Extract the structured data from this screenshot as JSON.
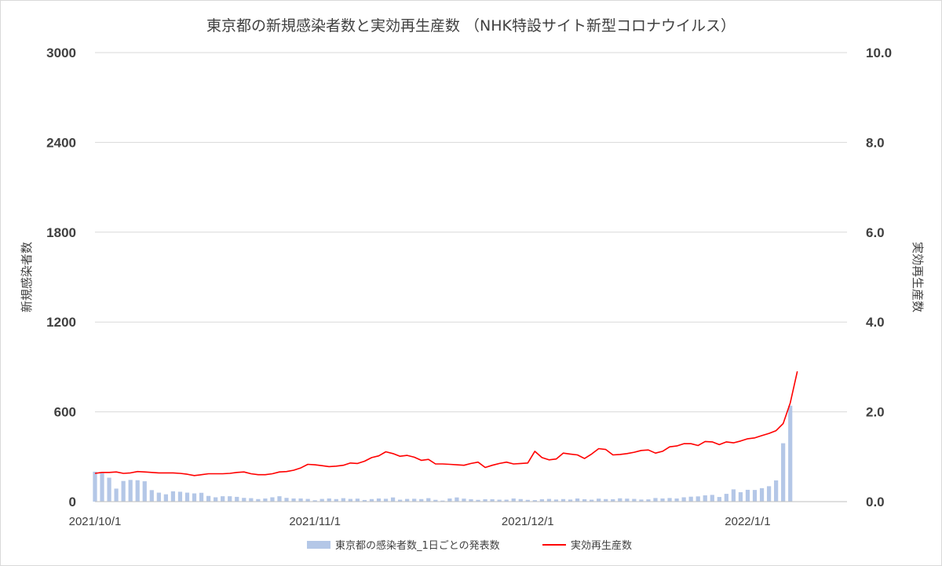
{
  "chart_data": {
    "type": "bar+line",
    "title": "東京都の新規感染者数と実効再生産数 （NHK特設サイト新型コロナウイルス）",
    "y_left": {
      "label": "新規感染者数",
      "lim": [
        0,
        3000
      ],
      "ticks": [
        "0",
        "600",
        "1200",
        "1800",
        "2400",
        "3000"
      ],
      "tick_values": [
        0,
        600,
        1200,
        1800,
        2400,
        3000
      ]
    },
    "y_right": {
      "label": "実効再生産数",
      "lim": [
        0,
        10
      ],
      "ticks": [
        "0.0",
        "2.0",
        "4.0",
        "6.0",
        "8.0",
        "10.0"
      ],
      "tick_values": [
        0,
        2,
        4,
        6,
        8,
        10
      ]
    },
    "x_ticks": [
      "2021/10/1",
      "2021/11/1",
      "2021/12/1",
      "2022/1/1"
    ],
    "x_tick_dates": [
      "2021-10-01",
      "2021-11-01",
      "2021-12-01",
      "2022-01-01"
    ],
    "x_range": [
      "2021-10-01",
      "2022-01-15"
    ],
    "grid": true,
    "legend_position": "bottom",
    "colors": {
      "bars": "#b4c7e7",
      "line": "#ff0000",
      "grid": "#d9d9d9",
      "text": "#404040"
    },
    "series": [
      {
        "name": "東京都の感染者数_1日ごとの発表数",
        "kind": "bar",
        "axis": "left",
        "dates": [
          "2021-10-01",
          "2021-10-02",
          "2021-10-03",
          "2021-10-04",
          "2021-10-05",
          "2021-10-06",
          "2021-10-07",
          "2021-10-08",
          "2021-10-09",
          "2021-10-10",
          "2021-10-11",
          "2021-10-12",
          "2021-10-13",
          "2021-10-14",
          "2021-10-15",
          "2021-10-16",
          "2021-10-17",
          "2021-10-18",
          "2021-10-19",
          "2021-10-20",
          "2021-10-21",
          "2021-10-22",
          "2021-10-23",
          "2021-10-24",
          "2021-10-25",
          "2021-10-26",
          "2021-10-27",
          "2021-10-28",
          "2021-10-29",
          "2021-10-30",
          "2021-10-31",
          "2021-11-01",
          "2021-11-02",
          "2021-11-03",
          "2021-11-04",
          "2021-11-05",
          "2021-11-06",
          "2021-11-07",
          "2021-11-08",
          "2021-11-09",
          "2021-11-10",
          "2021-11-11",
          "2021-11-12",
          "2021-11-13",
          "2021-11-14",
          "2021-11-15",
          "2021-11-16",
          "2021-11-17",
          "2021-11-18",
          "2021-11-19",
          "2021-11-20",
          "2021-11-21",
          "2021-11-22",
          "2021-11-23",
          "2021-11-24",
          "2021-11-25",
          "2021-11-26",
          "2021-11-27",
          "2021-11-28",
          "2021-11-29",
          "2021-11-30",
          "2021-12-01",
          "2021-12-02",
          "2021-12-03",
          "2021-12-04",
          "2021-12-05",
          "2021-12-06",
          "2021-12-07",
          "2021-12-08",
          "2021-12-09",
          "2021-12-10",
          "2021-12-11",
          "2021-12-12",
          "2021-12-13",
          "2021-12-14",
          "2021-12-15",
          "2021-12-16",
          "2021-12-17",
          "2021-12-18",
          "2021-12-19",
          "2021-12-20",
          "2021-12-21",
          "2021-12-22",
          "2021-12-23",
          "2021-12-24",
          "2021-12-25",
          "2021-12-26",
          "2021-12-27",
          "2021-12-28",
          "2021-12-29",
          "2021-12-30",
          "2021-12-31",
          "2022-01-01",
          "2022-01-02",
          "2022-01-03",
          "2022-01-04",
          "2022-01-05",
          "2022-01-06",
          "2022-01-07"
        ],
        "values": [
          200,
          190,
          160,
          87,
          138,
          145,
          143,
          136,
          77,
          60,
          49,
          69,
          66,
          60,
          55,
          59,
          38,
          29,
          36,
          36,
          32,
          25,
          23,
          17,
          21,
          29,
          36,
          25,
          21,
          21,
          18,
          9,
          18,
          21,
          17,
          23,
          18,
          20,
          11,
          17,
          21,
          19,
          28,
          13,
          18,
          19,
          17,
          23,
          12,
          7,
          21,
          28,
          20,
          16,
          12,
          16,
          16,
          13,
          13,
          21,
          17,
          12,
          10,
          16,
          18,
          14,
          17,
          14,
          21,
          16,
          13,
          20,
          17,
          16,
          22,
          20,
          18,
          14,
          15,
          24,
          21,
          24,
          21,
          29,
          33,
          35,
          42,
          45,
          31,
          52,
          82,
          63,
          79,
          78,
          90,
          103,
          142,
          390,
          641
        ]
      },
      {
        "name": "実効再生産数",
        "kind": "line",
        "axis": "right",
        "dates": [
          "2021-10-01",
          "2021-10-02",
          "2021-10-03",
          "2021-10-04",
          "2021-10-05",
          "2021-10-06",
          "2021-10-07",
          "2021-10-08",
          "2021-10-09",
          "2021-10-10",
          "2021-10-11",
          "2021-10-12",
          "2021-10-13",
          "2021-10-14",
          "2021-10-15",
          "2021-10-16",
          "2021-10-17",
          "2021-10-18",
          "2021-10-19",
          "2021-10-20",
          "2021-10-21",
          "2021-10-22",
          "2021-10-23",
          "2021-10-24",
          "2021-10-25",
          "2021-10-26",
          "2021-10-27",
          "2021-10-28",
          "2021-10-29",
          "2021-10-30",
          "2021-10-31",
          "2021-11-01",
          "2021-11-02",
          "2021-11-03",
          "2021-11-04",
          "2021-11-05",
          "2021-11-06",
          "2021-11-07",
          "2021-11-08",
          "2021-11-09",
          "2021-11-10",
          "2021-11-11",
          "2021-11-12",
          "2021-11-13",
          "2021-11-14",
          "2021-11-15",
          "2021-11-16",
          "2021-11-17",
          "2021-11-18",
          "2021-11-19",
          "2021-11-20",
          "2021-11-21",
          "2021-11-22",
          "2021-11-23",
          "2021-11-24",
          "2021-11-25",
          "2021-11-26",
          "2021-11-27",
          "2021-11-28",
          "2021-11-29",
          "2021-11-30",
          "2021-12-01",
          "2021-12-02",
          "2021-12-03",
          "2021-12-04",
          "2021-12-05",
          "2021-12-06",
          "2021-12-07",
          "2021-12-08",
          "2021-12-09",
          "2021-12-10",
          "2021-12-11",
          "2021-12-12",
          "2021-12-13",
          "2021-12-14",
          "2021-12-15",
          "2021-12-16",
          "2021-12-17",
          "2021-12-18",
          "2021-12-19",
          "2021-12-20",
          "2021-12-21",
          "2021-12-22",
          "2021-12-23",
          "2021-12-24",
          "2021-12-25",
          "2021-12-26",
          "2021-12-27",
          "2021-12-28",
          "2021-12-29",
          "2021-12-30",
          "2021-12-31",
          "2022-01-01",
          "2022-01-02",
          "2022-01-03",
          "2022-01-04",
          "2022-01-05",
          "2022-01-06",
          "2022-01-07",
          "2022-01-08"
        ],
        "values": [
          0.63,
          0.65,
          0.65,
          0.66,
          0.63,
          0.64,
          0.67,
          0.66,
          0.65,
          0.64,
          0.64,
          0.64,
          0.63,
          0.61,
          0.58,
          0.6,
          0.62,
          0.62,
          0.62,
          0.63,
          0.65,
          0.66,
          0.62,
          0.6,
          0.6,
          0.62,
          0.66,
          0.67,
          0.7,
          0.75,
          0.83,
          0.82,
          0.8,
          0.78,
          0.79,
          0.81,
          0.86,
          0.85,
          0.9,
          0.98,
          1.02,
          1.11,
          1.07,
          1.01,
          1.03,
          0.99,
          0.92,
          0.94,
          0.84,
          0.84,
          0.83,
          0.82,
          0.81,
          0.85,
          0.88,
          0.76,
          0.81,
          0.85,
          0.88,
          0.84,
          0.85,
          0.86,
          1.12,
          0.98,
          0.93,
          0.95,
          1.08,
          1.06,
          1.04,
          0.96,
          1.06,
          1.18,
          1.16,
          1.04,
          1.05,
          1.07,
          1.1,
          1.14,
          1.15,
          1.08,
          1.12,
          1.22,
          1.24,
          1.29,
          1.29,
          1.25,
          1.34,
          1.33,
          1.27,
          1.33,
          1.31,
          1.35,
          1.4,
          1.42,
          1.47,
          1.52,
          1.58,
          1.74,
          2.2,
          2.9
        ]
      }
    ]
  }
}
